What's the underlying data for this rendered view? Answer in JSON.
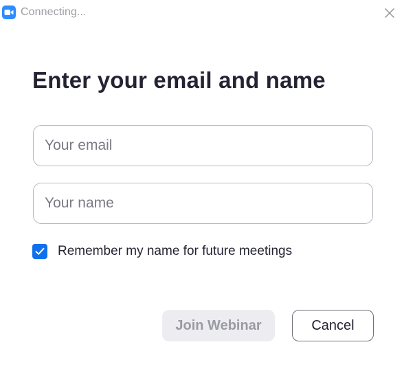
{
  "window": {
    "title": "Connecting...",
    "app_icon": "zoom-camera-icon",
    "close_icon": "close-icon"
  },
  "dialog": {
    "heading": "Enter your email and name",
    "email": {
      "placeholder": "Your email",
      "value": ""
    },
    "name": {
      "placeholder": "Your name",
      "value": ""
    },
    "remember": {
      "label": "Remember my name for future meetings",
      "checked": true
    },
    "buttons": {
      "join_label": "Join Webinar",
      "join_enabled": false,
      "cancel_label": "Cancel"
    }
  },
  "colors": {
    "brand_blue": "#2D8CFF",
    "checkbox_blue": "#0E71EB",
    "text_dark": "#232333",
    "disabled_bg": "#EDEDF1",
    "disabled_text": "#9A9AA3"
  }
}
